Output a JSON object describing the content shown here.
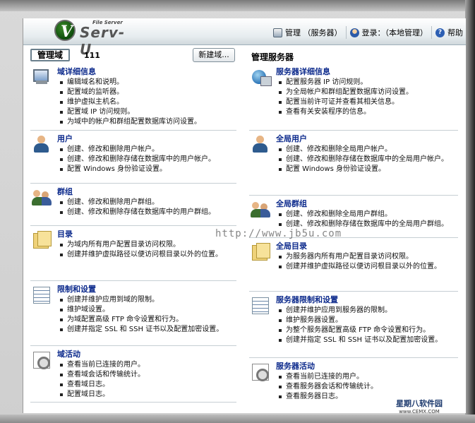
{
  "header": {
    "logo_small": "File Server",
    "logo_text": "Serv-U",
    "nav": [
      {
        "label": "管理 （服务器）",
        "icon": "manage-icon"
      },
      {
        "label": "登录：（本地管理）",
        "icon": "login-icon"
      },
      {
        "label": "帮助",
        "icon": "help-icon"
      }
    ]
  },
  "left": {
    "domain_label": "管理域",
    "domain_name": "111",
    "new_button": "新建域...",
    "sections": [
      {
        "title": "域详细信息",
        "icon": "computer-icon",
        "items": [
          "编辑域名和说明。",
          "配置域的监听器。",
          "维护虚拟主机名。",
          "配置域 IP 访问规则。",
          "为域中的帐户和群组配置数据库访问设置。"
        ]
      },
      {
        "title": "用户",
        "icon": "user-icon",
        "items": [
          "创建、修改和删除用户帐户。",
          "创建、修改和删除存储在数据库中的用户帐户。",
          "配置 Windows 身份验证设置。"
        ]
      },
      {
        "title": "群组",
        "icon": "group-icon",
        "items": [
          "创建、修改和删除用户群组。",
          "创建、修改和删除存储在数据库中的用户群组。"
        ]
      },
      {
        "title": "目录",
        "icon": "folder-icon",
        "items": [
          "为域内所有用户配置目录访问权限。",
          "创建并维护虚拟路径以便访问根目录以外的位置。"
        ]
      },
      {
        "title": "限制和设置",
        "icon": "list-icon",
        "items": [
          "创建并维护应用到域的限制。",
          "维护域设置。",
          "为域配置高级 FTP 命令设置和行为。",
          "创建并指定 SSL 和 SSH 证书以及配置加密设置。"
        ]
      },
      {
        "title": "域活动",
        "icon": "gear-icon",
        "items": [
          "查看当前已连接的用户。",
          "查看域会话和传输统计。",
          "查看域日志。",
          "配置域日志。"
        ]
      }
    ]
  },
  "right": {
    "title": "管理服务器",
    "sections": [
      {
        "title": "服务器详细信息",
        "icon": "globe-icon",
        "items": [
          "配置服务器 IP 访问规则。",
          "为全局帐户和群组配置数据库访问设置。",
          "配置当前许可证并查看其相关信息。",
          "查看有关安装程序的信息。"
        ]
      },
      {
        "title": "全局用户",
        "icon": "user-icon",
        "items": [
          "创建、修改和删除全局用户帐户。",
          "创建、修改和删除存储在数据库中的全局用户帐户。",
          "配置 Windows 身份验证设置。"
        ]
      },
      {
        "title": "全局群组",
        "icon": "group-icon",
        "items": [
          "创建、修改和删除全局用户群组。",
          "创建、修改和删除存储在数据库中的全局用户群组。"
        ]
      },
      {
        "title": "全局目录",
        "icon": "folder-icon",
        "items": [
          "为服务器内所有用户配置目录访问权限。",
          "创建并维护虚拟路径以便访问根目录以外的位置。"
        ]
      },
      {
        "title": "服务器限制和设置",
        "icon": "list-icon",
        "items": [
          "创建并维护应用到服务器的限制。",
          "维护服务器设置。",
          "为整个服务器配置高级 FTP 命令设置和行为。",
          "创建并指定 SSL 和 SSH 证书以及配置加密设置。"
        ]
      },
      {
        "title": "服务器活动",
        "icon": "gear-icon",
        "items": [
          "查看当前已连接的用户。",
          "查看服务器会话和传输统计。",
          "查看服务器日志。"
        ]
      }
    ]
  },
  "watermark": "http://www.jb5u.com",
  "brand": {
    "cn": "星期八软件园",
    "url": "www.CEMX.COM"
  }
}
